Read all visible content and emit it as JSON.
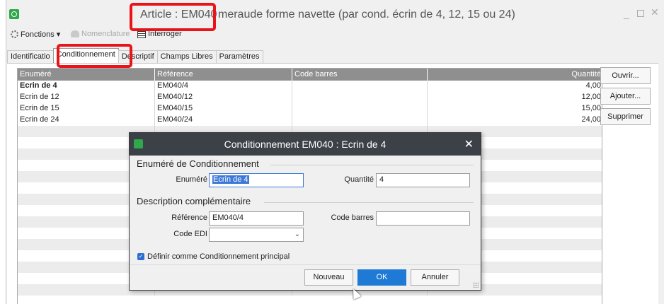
{
  "window": {
    "title_prefix": "Article : EM040",
    "title_rest": "meraude forme navette (par cond. écrin de 4, 12, 15 ou 24)",
    "minimize": "_",
    "close": "✕"
  },
  "toolbar": {
    "functions": "Fonctions ▾",
    "nomenclature": "Nomenclature",
    "query": "Interroger"
  },
  "tabs": [
    {
      "label": "Identificatio"
    },
    {
      "label": "Conditionnement"
    },
    {
      "label": "Descriptif"
    },
    {
      "label": "Champs Libres"
    },
    {
      "label": "Paramètres"
    }
  ],
  "grid": {
    "columns": [
      "Enuméré",
      "Référence",
      "Code barres",
      "Quantité"
    ],
    "rows": [
      {
        "enumere": "Ecrin de 4",
        "reference": "EM040/4",
        "code_barres": "",
        "quantite": "4,00"
      },
      {
        "enumere": "Ecrin de 12",
        "reference": "EM040/12",
        "code_barres": "",
        "quantite": "12,00"
      },
      {
        "enumere": "Ecrin de 15",
        "reference": "EM040/15",
        "code_barres": "",
        "quantite": "15,00"
      },
      {
        "enumere": "Ecrin de 24",
        "reference": "EM040/24",
        "code_barres": "",
        "quantite": "24,00"
      }
    ]
  },
  "side_buttons": {
    "open": "Ouvrir...",
    "add": "Ajouter...",
    "delete": "Supprimer"
  },
  "dialog": {
    "title": "Conditionnement EM040 :  Ecrin de 4",
    "close": "✕",
    "section1": "Enuméré de Conditionnement",
    "enumere_label": "Enuméré",
    "enumere_value": "Ecrin de 4",
    "quantite_label": "Quantité",
    "quantite_value": "4",
    "section2": "Description complémentaire",
    "reference_label": "Référence",
    "reference_value": "EM040/4",
    "code_barres_label": "Code barres",
    "code_barres_value": "",
    "code_edi_label": "Code EDI",
    "code_edi_value": "",
    "checkbox_label": "Définir comme Conditionnement principal",
    "checkbox_checked": true,
    "btn_new": "Nouveau",
    "btn_ok": "OK",
    "btn_cancel": "Annuler"
  }
}
